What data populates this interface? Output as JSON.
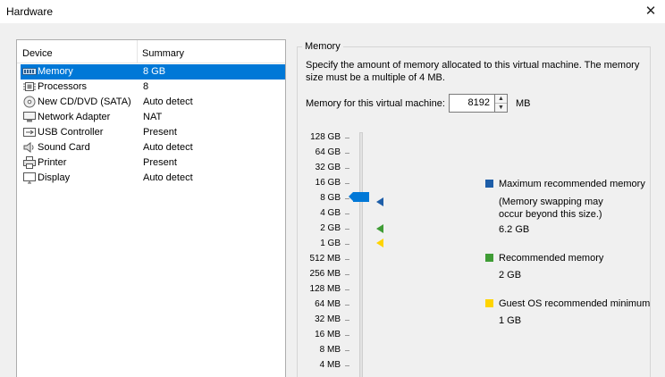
{
  "window": {
    "title": "Hardware",
    "close_glyph": "✕"
  },
  "device_list": {
    "headers": {
      "device": "Device",
      "summary": "Summary"
    },
    "items": [
      {
        "name": "Memory",
        "summary": "8 GB",
        "icon": "memory-icon",
        "selected": true
      },
      {
        "name": "Processors",
        "summary": "8",
        "icon": "processor-icon"
      },
      {
        "name": "New CD/DVD (SATA)",
        "summary": "Auto detect",
        "icon": "cd-dvd-icon"
      },
      {
        "name": "Network Adapter",
        "summary": "NAT",
        "icon": "network-adapter-icon"
      },
      {
        "name": "USB Controller",
        "summary": "Present",
        "icon": "usb-icon"
      },
      {
        "name": "Sound Card",
        "summary": "Auto detect",
        "icon": "speaker-icon"
      },
      {
        "name": "Printer",
        "summary": "Present",
        "icon": "printer-icon"
      },
      {
        "name": "Display",
        "summary": "Auto detect",
        "icon": "monitor-icon"
      }
    ]
  },
  "memory": {
    "group_title": "Memory",
    "description": "Specify the amount of memory allocated to this virtual machine. The memory size must be a multiple of 4 MB.",
    "field_label": "Memory for this virtual machine:",
    "value": "8192",
    "unit": "MB",
    "slider_ticks": [
      "128 GB",
      "64 GB",
      "32 GB",
      "16 GB",
      "8 GB",
      "4 GB",
      "2 GB",
      "1 GB",
      "512 MB",
      "256 MB",
      "128 MB",
      "64 MB",
      "32 MB",
      "16 MB",
      "8 MB",
      "4 MB"
    ],
    "slider_value": "8 GB",
    "markers": {
      "maximum": "8 GB",
      "recommended": "2 GB",
      "guest_minimum": "1 GB"
    },
    "legend": {
      "maximum": {
        "label": "Maximum recommended memory",
        "note_line1": "(Memory swapping may",
        "note_line2": "occur beyond this size.)",
        "value": "6.2 GB",
        "color": "#1e5ea8"
      },
      "recommended": {
        "label": "Recommended memory",
        "value": "2 GB",
        "color": "#3f9c35"
      },
      "guest_minimum": {
        "label": "Guest OS recommended minimum",
        "value": "1 GB",
        "color": "#ffd400"
      }
    }
  }
}
